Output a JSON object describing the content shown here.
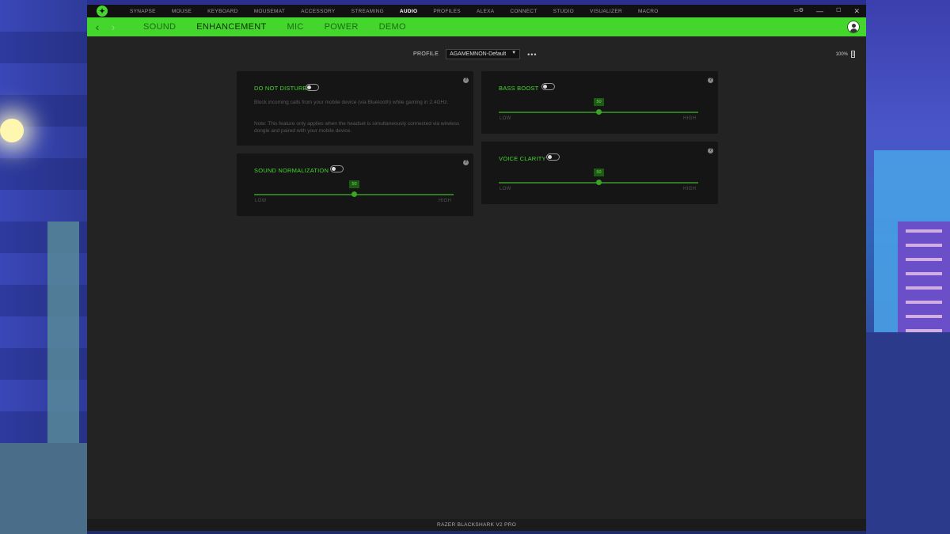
{
  "titlebar": {
    "nav": [
      "SYNAPSE",
      "MOUSE",
      "KEYBOARD",
      "MOUSEMAT",
      "ACCESSORY",
      "STREAMING",
      "AUDIO",
      "PROFILES",
      "ALEXA",
      "CONNECT",
      "STUDIO",
      "VISUALIZER",
      "MACRO"
    ],
    "active_nav": "AUDIO"
  },
  "subbar": {
    "tabs": [
      "SOUND",
      "ENHANCEMENT",
      "MIC",
      "POWER",
      "DEMO"
    ],
    "active_tab": "ENHANCEMENT"
  },
  "profile": {
    "label": "PROFILE",
    "selected": "AGAMEMNON-Default",
    "more": "•••"
  },
  "battery": {
    "text": "100%",
    "percent": 100
  },
  "cards": {
    "dnd": {
      "title": "DO NOT DISTURB",
      "enabled": false,
      "desc1": "Block incoming calls from your mobile device (via Bluetooth) while gaming in 2.4GHz.",
      "desc2": "Note: This feature only applies when the headset is simultaneously connected via wireless dongle and paired with your mobile device."
    },
    "sound_normalization": {
      "title": "SOUND NORMALIZATION",
      "enabled": false,
      "value": "50",
      "level": 0.5,
      "low": "LOW",
      "high": "HIGH"
    },
    "bass_boost": {
      "title": "BASS BOOST",
      "enabled": false,
      "value": "50",
      "level": 0.5,
      "low": "LOW",
      "high": "HIGH"
    },
    "voice_clarity": {
      "title": "VOICE CLARITY",
      "enabled": false,
      "value": "50",
      "level": 0.5,
      "low": "LOW",
      "high": "HIGH"
    }
  },
  "status": {
    "device": "RAZER BLACKSHARK V2 PRO"
  },
  "colors": {
    "accent": "#44d62c",
    "background": "#232323",
    "card": "#151515"
  }
}
